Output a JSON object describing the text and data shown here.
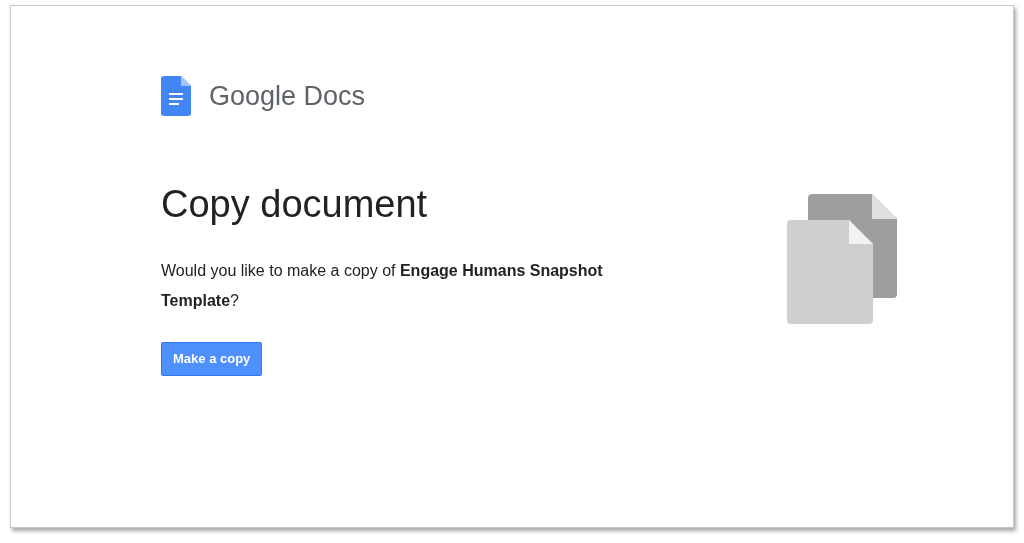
{
  "logo": {
    "text": "Google Docs"
  },
  "title": "Copy document",
  "message": "Would you like to make a copy of **Engage Humans Snapshot Template**?",
  "button": "Make a copy"
}
